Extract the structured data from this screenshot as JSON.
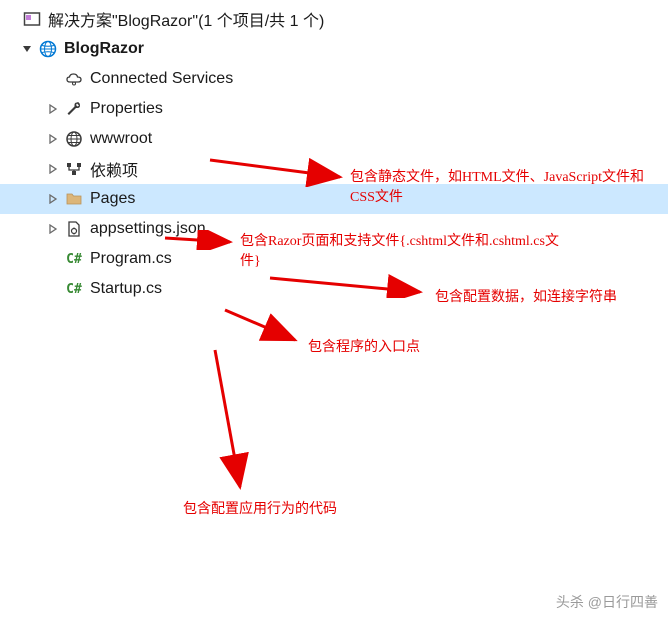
{
  "solution": {
    "title": "解决方案\"BlogRazor\"(1 个项目/共 1 个)"
  },
  "project": {
    "name": "BlogRazor"
  },
  "nodes": {
    "connected_services": "Connected Services",
    "properties": "Properties",
    "wwwroot": "wwwroot",
    "dependencies": "依赖项",
    "pages": "Pages",
    "appsettings": "appsettings.json",
    "program": "Program.cs",
    "startup": "Startup.cs"
  },
  "annotations": {
    "wwwroot": "包含静态文件，如HTML文件、JavaScript文件和CSS文件",
    "pages": "包含Razor页面和支持文件{.cshtml文件和.cshtml.cs文件}",
    "appsettings": "包含配置数据，如连接字符串",
    "program": "包含程序的入口点",
    "startup": "包含配置应用行为的代码"
  },
  "watermark": "头杀 @日行四善"
}
